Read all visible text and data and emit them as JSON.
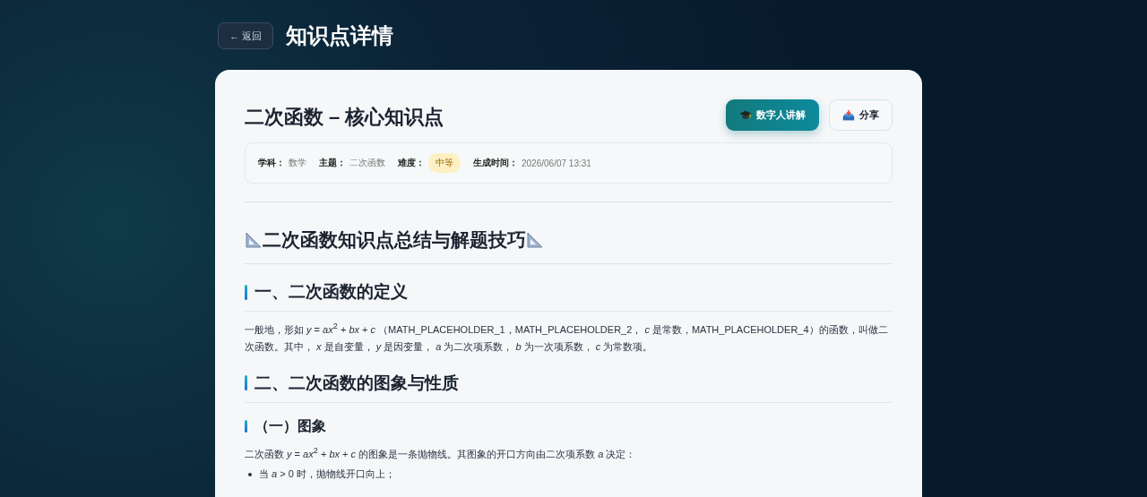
{
  "back_button": {
    "label": "← 返回"
  },
  "page_title": "知识点详情",
  "card": {
    "title": "二次函数 – 核心知识点",
    "buttons": [
      {
        "label": "数字人讲解",
        "kind": "primary"
      },
      {
        "label": "分享",
        "kind": "secondary"
      }
    ],
    "meta": [
      {
        "label": "学科：",
        "value": "数学"
      },
      {
        "label": "主题：",
        "value": "二次函数"
      },
      {
        "label": "难度：",
        "value": "中等",
        "kind": "badge"
      },
      {
        "label": "生成时间：",
        "value": "2026/06/07 13:31"
      }
    ],
    "content": [
      {
        "kind": "h1",
        "text": "二次函数知识点总结与解题技巧"
      },
      {
        "kind": "h2",
        "text": "一、二次函数的定义"
      },
      {
        "kind": "p",
        "text": "一般地，形如 *y* = *ax*$^{2}$ + *bx* + *c* （MATH_PLACEHOLDER_1，MATH_PLACEHOLDER_2， *c* 是常数，MATH_PLACEHOLDER_4）的函数，叫做二次函数。其中， *x* 是自变量， *y* 是因变量， *a* 为二次项系数， *b* 为一次项系数， *c* 为常数项。"
      },
      {
        "kind": "h2",
        "text": "二、二次函数的图象与性质"
      },
      {
        "kind": "h3",
        "text": "（一）图象"
      },
      {
        "kind": "p",
        "text": "二次函数 *y* = *ax*$^{2}$ + *bx* + *c* 的图象是一条抛物线。其图象的开口方向由二次项系数 *a* 决定："
      },
      {
        "kind": "li",
        "text": "当 *a* > 0 时，抛物线开口向上；"
      }
    ]
  }
}
